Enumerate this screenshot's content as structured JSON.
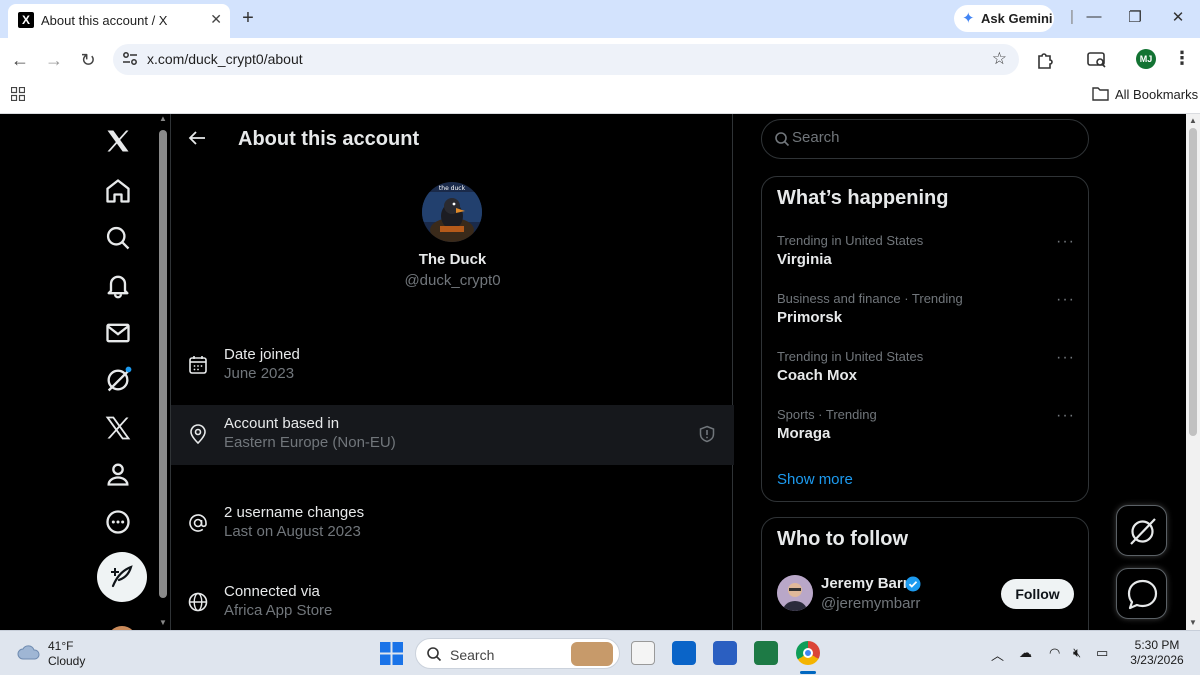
{
  "browser": {
    "tab_title": "About this account / X",
    "tab_favicon": "X",
    "gemini_label": "Ask Gemini",
    "url": "x.com/duck_crypt0/about",
    "profile_initials": "MJ",
    "bookmarks_label": "All Bookmarks"
  },
  "x": {
    "page_title": "About this account",
    "profile": {
      "name": "The Duck",
      "handle": "@duck_crypt0",
      "avatar_caption": "the duck"
    },
    "rows": [
      {
        "icon": "calendar-icon",
        "title": "Date joined",
        "value": "June 2023"
      },
      {
        "icon": "location-pin-icon",
        "title": "Account based in",
        "value": "Eastern Europe (Non-EU)"
      },
      {
        "icon": "at-sign-icon",
        "title": "2 username changes",
        "value": "Last on August 2023"
      },
      {
        "icon": "globe-icon",
        "title": "Connected via",
        "value": "Africa App Store"
      }
    ],
    "search_placeholder": "Search",
    "trends": {
      "title": "What’s happening",
      "items": [
        {
          "context": "Trending in United States",
          "name": "Virginia"
        },
        {
          "context": "Business and finance · Trending",
          "name": "Primorsk"
        },
        {
          "context": "Trending in United States",
          "name": "Coach Mox"
        },
        {
          "context": "Sports · Trending",
          "name": "Moraga"
        }
      ],
      "more_glyph": "···",
      "show_more": "Show more"
    },
    "who_to_follow": {
      "title": "Who to follow",
      "name": "Jeremy Barr",
      "handle": "@jeremymbarr",
      "follow_label": "Follow"
    },
    "colors": {
      "accent": "#1d9bf0",
      "text": "#e7e9ea",
      "muted": "#71767b",
      "border": "#2f3336"
    }
  },
  "taskbar": {
    "temperature": "41°F",
    "condition": "Cloudy",
    "search_label": "Search",
    "time": "5:30 PM",
    "date": "3/23/2026"
  }
}
